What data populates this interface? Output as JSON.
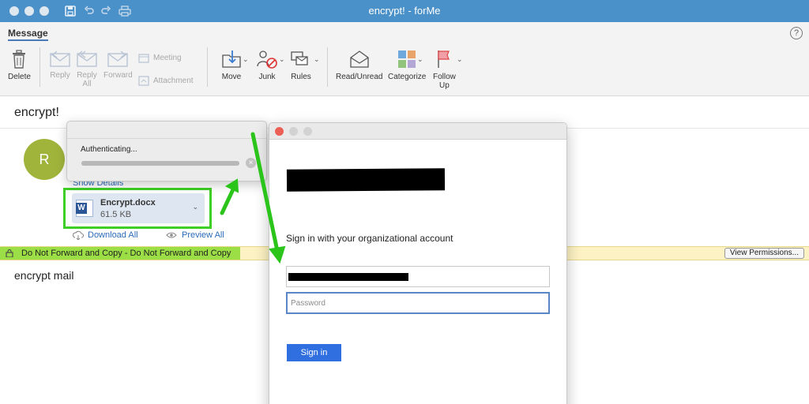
{
  "window": {
    "title": "encrypt! - forMe"
  },
  "ribbon": {
    "tab": "Message",
    "help": "?",
    "delete": "Delete",
    "reply": "Reply",
    "reply_all": "Reply\nAll",
    "forward": "Forward",
    "meeting": "Meeting",
    "attachment": "Attachment",
    "move": "Move",
    "junk": "Junk",
    "rules": "Rules",
    "read_unread": "Read/Unread",
    "categorize": "Categorize",
    "follow_up": "Follow\nUp"
  },
  "message": {
    "subject": "encrypt!",
    "avatar_initial": "R",
    "show_details": "Show Details",
    "attachment": {
      "name": "Encrypt.docx",
      "size": "61.5 KB",
      "icon": "word-file-icon"
    },
    "download_all": "Download All",
    "preview_all": "Preview All",
    "protection": {
      "text": "Do Not Forward and Copy - Do Not Forward and Copy",
      "view_permissions": "View Permissions..."
    },
    "body": "encrypt mail"
  },
  "auth_popup": {
    "label": "Authenticating...",
    "progress": 1.0
  },
  "signin": {
    "title": "Sign in with your organizational account",
    "password_placeholder": "Password",
    "button": "Sign in"
  },
  "colors": {
    "titlebar": "#4a90c9",
    "highlight": "#3ecf26",
    "link": "#2a6ab8",
    "signin_button": "#2f6fe0",
    "avatar": "#a0b43c"
  }
}
